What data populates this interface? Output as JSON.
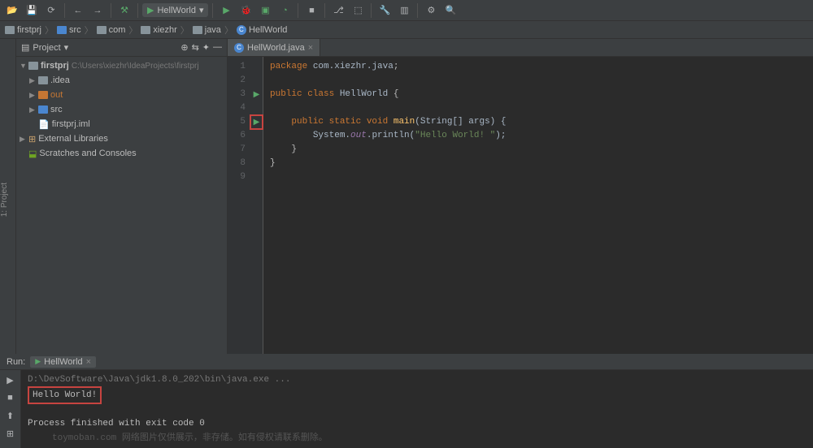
{
  "toolbar": {
    "run_config_label": "HellWorld"
  },
  "breadcrumb": [
    "firstprj",
    "src",
    "com",
    "xiezhr",
    "java",
    "HellWorld"
  ],
  "project_panel": {
    "title": "Project",
    "root_name": "firstprj",
    "root_path": "C:\\Users\\xiezhr\\IdeaProjects\\firstprj",
    "items": [
      {
        "name": ".idea",
        "icon": "folder"
      },
      {
        "name": "out",
        "icon": "folder-orange"
      },
      {
        "name": "src",
        "icon": "folder-blue"
      },
      {
        "name": "firstprj.iml",
        "icon": "file"
      }
    ],
    "external": "External Libraries",
    "scratches": "Scratches and Consoles"
  },
  "editor": {
    "tab_label": "HellWorld.java",
    "line_count": 9,
    "code": {
      "l1_pkg": "package",
      "l1_pkgname": "com.xiezhr.java",
      "l3_pub": "public class",
      "l3_cls": "HellWorld",
      "l5_sig_pub": "public static void",
      "l5_main": "main",
      "l5_args": "(String[] args) {",
      "l6_sys": "System.",
      "l6_out": "out",
      "l6_println": ".println(",
      "l6_str": "\"Hello World! \"",
      "l6_end": ");"
    }
  },
  "run": {
    "label": "Run:",
    "tab": "HellWorld",
    "cmd": "D:\\DevSoftware\\Java\\jdk1.8.0_202\\bin\\java.exe ...",
    "output": "Hello World!",
    "exit": "Process finished with exit code 0"
  },
  "footer_text": "toymoban.com 网络图片仅供展示，非存储。如有侵权请联系删除。",
  "chart_data": null
}
